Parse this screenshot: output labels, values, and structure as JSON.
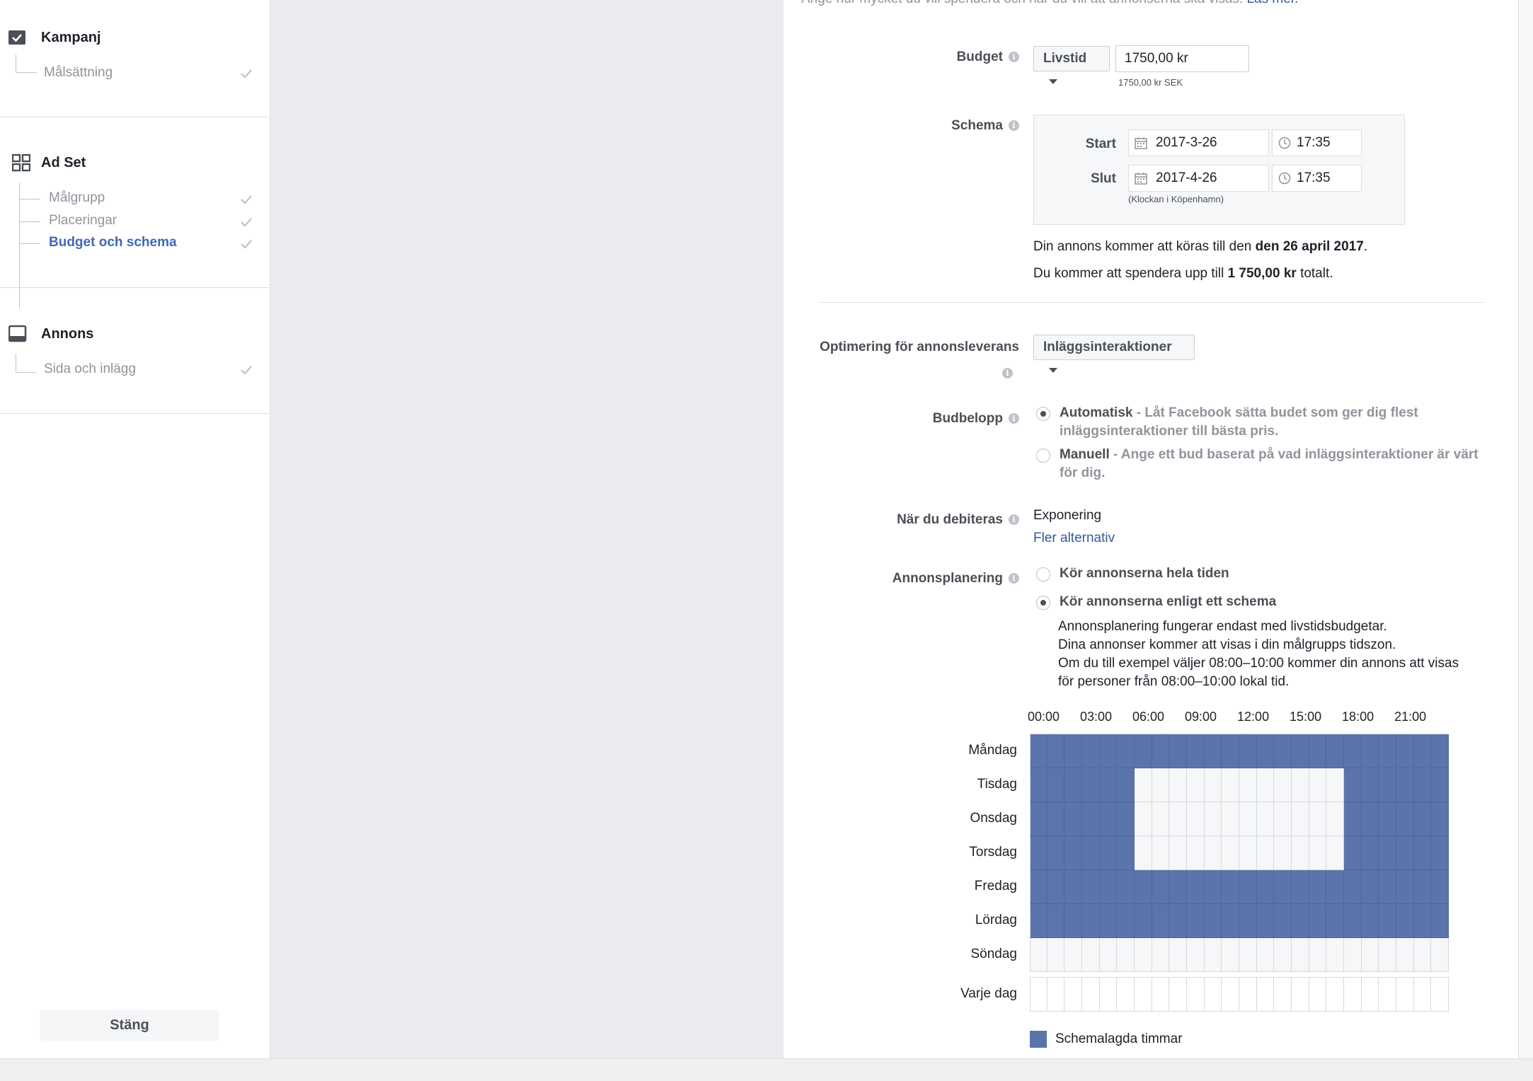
{
  "sidebar": {
    "campaign": {
      "title": "Kampanj",
      "items": [
        {
          "label": "Målsättning"
        }
      ]
    },
    "adset": {
      "title": "Ad Set",
      "items": [
        {
          "label": "Målgrupp"
        },
        {
          "label": "Placeringar"
        },
        {
          "label": "Budget och schema",
          "active": true
        }
      ]
    },
    "ad": {
      "title": "Annons",
      "items": [
        {
          "label": "Sida och inlägg"
        }
      ]
    },
    "close_label": "Stäng"
  },
  "header": {
    "intro_text": "Ange hur mycket du vill spendera och när du vill att annonserna ska visas.",
    "learn_more": "Läs mer."
  },
  "budget": {
    "label": "Budget",
    "type": "Livstid",
    "amount": "1750,00 kr",
    "currency_note": "1750,00 kr SEK"
  },
  "schedule": {
    "label": "Schema",
    "start_label": "Start",
    "start_date": "2017-3-26",
    "start_time": "17:35",
    "end_label": "Slut",
    "end_date": "2017-4-26",
    "end_time": "17:35",
    "tz_note": "(Klockan i Köpenhamn)",
    "run_until_prefix": "Din annons kommer att köras till den",
    "run_until_date": "den 26 april 2017",
    "run_until_suffix": ".",
    "spend_prefix": "Du kommer att spendera upp till",
    "spend_amount": "1 750,00 kr",
    "spend_suffix": "totalt."
  },
  "optimization": {
    "label": "Optimering för annonsleverans",
    "value": "Inläggsinteraktioner"
  },
  "bid": {
    "label": "Budbelopp",
    "auto_title": "Automatisk",
    "auto_desc_line1": " - Låt Facebook sätta budet som ger dig flest",
    "auto_desc_line2": "inläggsinteraktioner till bästa pris.",
    "manual_title": "Manuell",
    "manual_desc_line1": " - Ange ett bud baserat på vad inläggsinteraktioner är värt",
    "manual_desc_line2": "för dig."
  },
  "billing": {
    "label": "När du debiteras",
    "value": "Exponering",
    "more_link": "Fler alternativ"
  },
  "ad_scheduling": {
    "label": "Annonsplanering",
    "option_always": "Kör annonserna hela tiden",
    "option_schedule": "Kör annonserna enligt ett schema",
    "note_line1": "Annonsplanering fungerar endast med livstidsbudgetar.",
    "note_line2": "Dina annonser kommer att visas i din målgrupps tidszon.",
    "note_line3": "Om du till exempel väljer 08:00–10:00 kommer din annons att visas",
    "note_line4": "för personer från 08:00–10:00 lokal tid.",
    "hours": [
      "00:00",
      "03:00",
      "06:00",
      "09:00",
      "12:00",
      "15:00",
      "18:00",
      "21:00"
    ],
    "days": [
      {
        "name": "Måndag",
        "blocks": [
          [
            0,
            24
          ]
        ]
      },
      {
        "name": "Tisdag",
        "blocks": [
          [
            0,
            6
          ],
          [
            18,
            24
          ]
        ]
      },
      {
        "name": "Onsdag",
        "blocks": [
          [
            0,
            6
          ],
          [
            18,
            24
          ]
        ]
      },
      {
        "name": "Torsdag",
        "blocks": [
          [
            0,
            6
          ],
          [
            18,
            24
          ]
        ]
      },
      {
        "name": "Fredag",
        "blocks": [
          [
            0,
            24
          ]
        ]
      },
      {
        "name": "Lördag",
        "blocks": [
          [
            0,
            24
          ]
        ]
      },
      {
        "name": "Söndag",
        "blocks": []
      }
    ],
    "every_day_label": "Varje dag",
    "legend_label": "Schemalagda timmar",
    "scheduled_color": "#5b74ab"
  }
}
